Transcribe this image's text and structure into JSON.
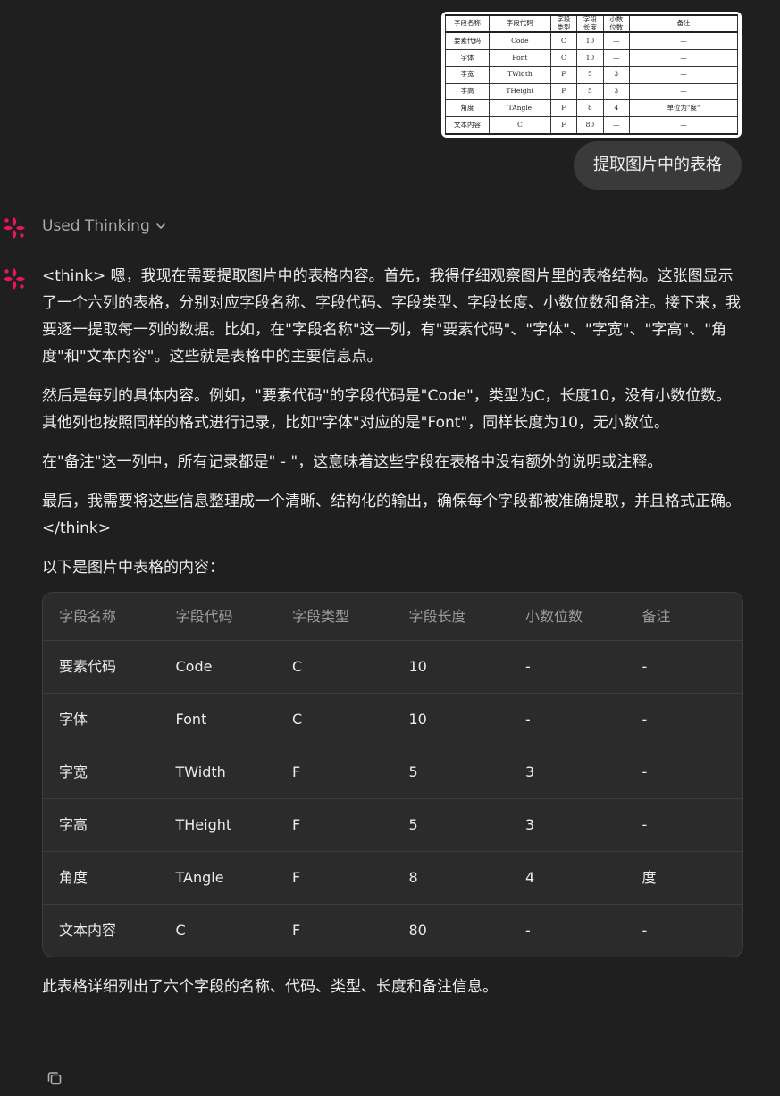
{
  "user_message": {
    "image_table": {
      "headers": [
        "字段名称",
        "字段代码",
        "字段\n类型",
        "字段\n长度",
        "小数\n位数",
        "备注"
      ],
      "rows": [
        [
          "要素代码",
          "Code",
          "C",
          "10",
          "—",
          "—"
        ],
        [
          "字体",
          "Font",
          "C",
          "10",
          "—",
          "—"
        ],
        [
          "字宽",
          "TWidth",
          "F",
          "5",
          "3",
          "—"
        ],
        [
          "字高",
          "THeight",
          "F",
          "5",
          "3",
          "—"
        ],
        [
          "角度",
          "TAngle",
          "F",
          "8",
          "4",
          "单位为\"度\""
        ],
        [
          "文本内容",
          "C",
          "F",
          "80",
          "—",
          "—"
        ]
      ]
    },
    "text": "提取图片中的表格"
  },
  "assistant": {
    "thinking_label": "Used Thinking",
    "paragraphs": [
      "<think> 嗯，我现在需要提取图片中的表格内容。首先，我得仔细观察图片里的表格结构。这张图显示了一个六列的表格，分别对应字段名称、字段代码、字段类型、字段长度、小数位数和备注。接下来，我要逐一提取每一列的数据。比如，在\"字段名称\"这一列，有\"要素代码\"、\"字体\"、\"字宽\"、\"字高\"、\"角度\"和\"文本内容\"。这些就是表格中的主要信息点。",
      "然后是每列的具体内容。例如，\"要素代码\"的字段代码是\"Code\"，类型为C，长度10，没有小数位数。其他列也按照同样的格式进行记录，比如\"字体\"对应的是\"Font\"，同样长度为10，无小数位。",
      "在\"备注\"这一列中，所有记录都是\" - \"，这意味着这些字段在表格中没有额外的说明或注释。",
      "最后，我需要将这些信息整理成一个清晰、结构化的输出，确保每个字段都被准确提取，并且格式正确。"
    ],
    "think_close": "</think>",
    "intro": "以下是图片中表格的内容：",
    "table": {
      "headers": [
        "字段名称",
        "字段代码",
        "字段类型",
        "字段长度",
        "小数位数",
        "备注"
      ],
      "rows": [
        [
          "要素代码",
          "Code",
          "C",
          "10",
          "-",
          "-"
        ],
        [
          "字体",
          "Font",
          "C",
          "10",
          "-",
          "-"
        ],
        [
          "字宽",
          "TWidth",
          "F",
          "5",
          "3",
          "-"
        ],
        [
          "字高",
          "THeight",
          "F",
          "5",
          "3",
          "-"
        ],
        [
          "角度",
          "TAngle",
          "F",
          "8",
          "4",
          "度"
        ],
        [
          "文本内容",
          "C",
          "F",
          "80",
          "-",
          "-"
        ]
      ]
    },
    "summary": "此表格详细列出了六个字段的名称、代码、类型、长度和备注信息。"
  },
  "icons": {
    "avatar": "assistant-logo-icon",
    "chevron": "chevron-down-icon",
    "copy": "copy-icon"
  },
  "colors": {
    "background": "#1f1f1f",
    "user_bubble": "#3a3a3a",
    "logo_accent": "#e8175d",
    "table_bg": "#2b2b2b"
  }
}
